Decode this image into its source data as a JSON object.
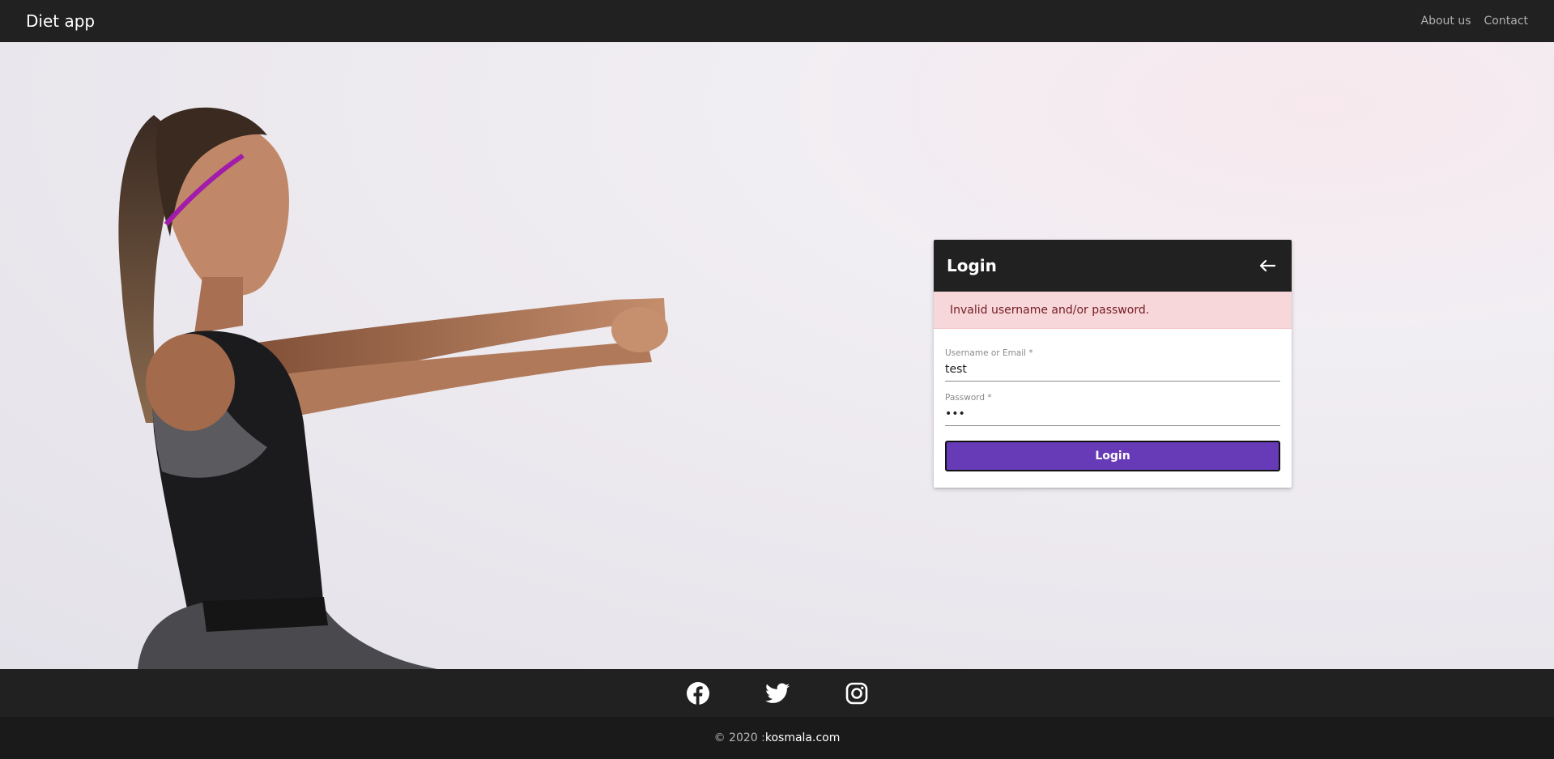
{
  "header": {
    "brand": "Diet app",
    "nav": [
      {
        "label": "About us"
      },
      {
        "label": "Contact"
      }
    ]
  },
  "hero": {
    "image": "woman-stretching-photo"
  },
  "login": {
    "title": "Login",
    "back_icon": "arrow-left-icon",
    "error": "Invalid username and/or password.",
    "username": {
      "label": "Username or Email *",
      "value": "test"
    },
    "password": {
      "label": "Password *",
      "value": "•••"
    },
    "submit_label": "Login"
  },
  "footer": {
    "social": [
      {
        "icon": "facebook-icon"
      },
      {
        "icon": "twitter-icon"
      },
      {
        "icon": "instagram-icon"
      }
    ],
    "copyright_prefix": "© 2020 : ",
    "copyright_link": "kosmala.com"
  },
  "colors": {
    "header_bg": "#212121",
    "footer_bg": "#1a1a1a",
    "accent": "#673ab7",
    "alert_bg": "#f8d7da",
    "alert_text": "#721c24"
  }
}
